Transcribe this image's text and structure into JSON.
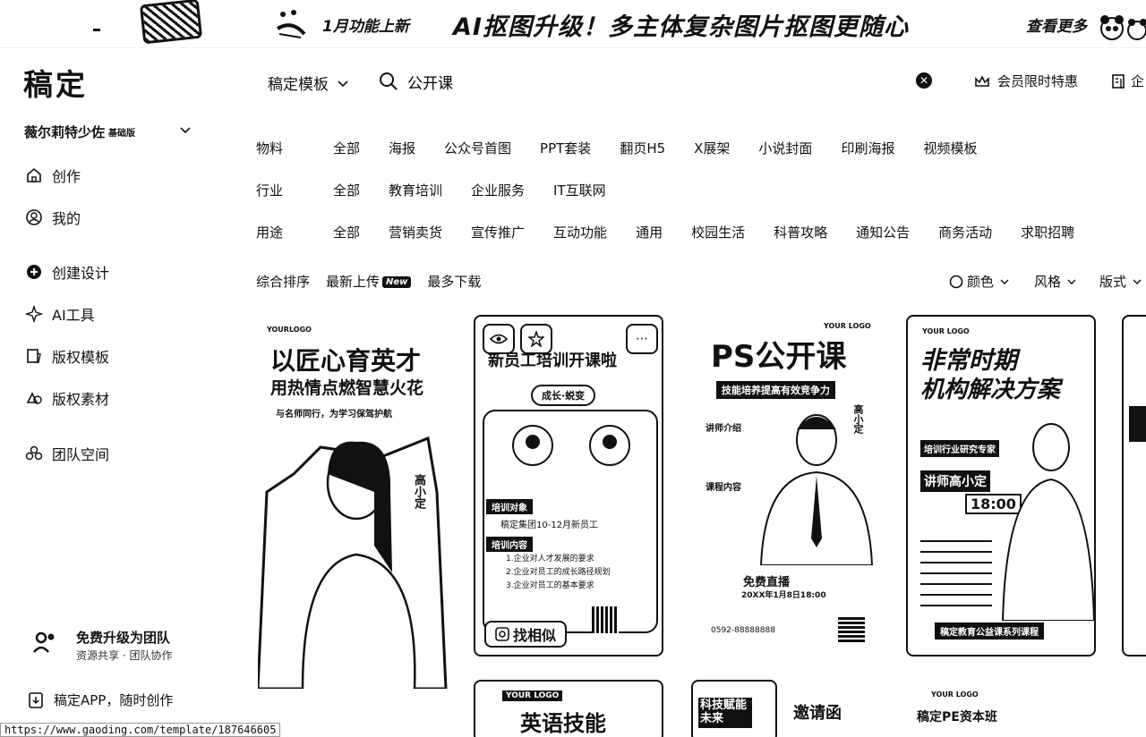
{
  "banner": {
    "small_text": "1月功能上新",
    "main_text": "AI抠图升级！多主体复杂图片抠图更随心",
    "more": "查看更多"
  },
  "logo": "稿定",
  "account": {
    "name": "薇尔莉特少佐",
    "plan": "基础版"
  },
  "sidebar": {
    "items": [
      {
        "label": "创作",
        "icon": "home-icon"
      },
      {
        "label": "我的",
        "icon": "user-icon"
      },
      {
        "label": "创建设计",
        "icon": "plus-circle-icon"
      },
      {
        "label": "AI工具",
        "icon": "sparkle-icon"
      },
      {
        "label": "版权模板",
        "icon": "template-icon"
      },
      {
        "label": "版权素材",
        "icon": "material-icon"
      },
      {
        "label": "团队空间",
        "icon": "team-icon"
      }
    ],
    "promo_title": "免费升级为团队",
    "promo_sub": "资源共享 · 团队协作",
    "app_download": "稿定APP，随时创作"
  },
  "status_url": "https://www.gaoding.com/template/187646605",
  "topbar": {
    "template_dropdown": "稿定模板",
    "search_value": "公开课",
    "vip": "会员限时特惠",
    "enterprise": "企"
  },
  "filters": {
    "material": {
      "label": "物料",
      "items": [
        "全部",
        "海报",
        "公众号首图",
        "PPT套装",
        "翻页H5",
        "X展架",
        "小说封面",
        "印刷海报",
        "视频模板"
      ]
    },
    "industry": {
      "label": "行业",
      "items": [
        "全部",
        "教育培训",
        "企业服务",
        "IT互联网"
      ]
    },
    "usage": {
      "label": "用途",
      "items": [
        "全部",
        "营销卖货",
        "宣传推广",
        "互动功能",
        "通用",
        "校园生活",
        "科普攻略",
        "通知公告",
        "商务活动",
        "求职招聘"
      ]
    }
  },
  "sort": {
    "comprehensive": "综合排序",
    "newest": "最新上传",
    "new_badge": "New",
    "most_downloaded": "最多下载",
    "color": "颜色",
    "style": "风格",
    "layout": "版式"
  },
  "cards": [
    {
      "logo": "YOURLOGO",
      "title1": "以匠心育英才",
      "title2": "用热情点燃智慧火花",
      "sub": "与名师同行，为学习保驾护航",
      "teacher": "高小定"
    },
    {
      "title": "新员工培训开课啦",
      "pill": "成长·蜕变",
      "target_label": "培训对象",
      "target": "稿定集团10-12月新员工",
      "content_label": "培训内容",
      "points": [
        "1.企业对人才发展的要求",
        "2.企业对员工的成长路径规划",
        "3.企业对员工的基本要求"
      ],
      "find_similar": "找相似"
    },
    {
      "logo": "YOUR LOGO",
      "title": "PS公开课",
      "sub": "技能培养提高有效竞争力",
      "teacher": "高小定",
      "sec1": "讲师介绍",
      "sec2": "课程内容",
      "live": "免费直播",
      "date": "20XX年1月8日18:00",
      "phone": "0592-88888888"
    },
    {
      "logo": "YOUR LOGO",
      "title1": "非常时期",
      "title2": "机构解决方案",
      "tag": "培训行业研究专家",
      "teacher": "讲师高小定",
      "time": "18:00",
      "footer": "稿定教育公益课系列课程"
    },
    {
      "title": "英语技能",
      "logo": "YOUR LOGO"
    },
    {
      "title": "科技赋能未来",
      "sub": "邀请函"
    },
    {
      "logo": "YOUR LOGO",
      "title": "稿定PE资本班"
    }
  ],
  "colors": {
    "ink": "#111111",
    "bg": "#ffffff"
  }
}
